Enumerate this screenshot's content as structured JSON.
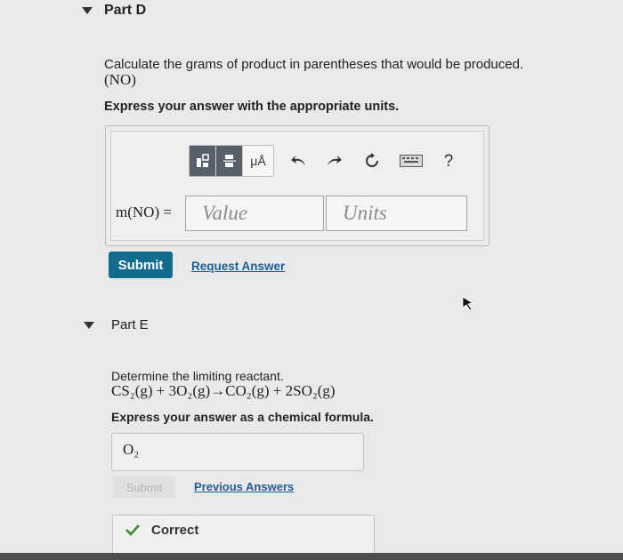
{
  "part_d": {
    "title": "Part D",
    "prompt_line1": "Calculate the grams of product in parentheses that would be produced.",
    "prompt_line2": "(NO)",
    "instruction": "Express your answer with the appropriate units.",
    "toolbar": {
      "template_icon": "templates-icon",
      "units_label": "μÅ",
      "undo_icon": "undo-icon",
      "redo_icon": "redo-icon",
      "reset_icon": "reset-icon",
      "keyboard_icon": "keyboard-icon",
      "help_label": "?"
    },
    "answer_label": "m(NO) =",
    "value_placeholder": "Value",
    "units_placeholder": "Units",
    "submit_label": "Submit",
    "request_answer_label": "Request Answer"
  },
  "part_e": {
    "title": "Part E",
    "prompt": "Determine the limiting reactant.",
    "equation": "CS₂(g) + 3O₂(g)→CO₂(g) + 2SO₂(g)",
    "instruction": "Express your answer as a chemical formula.",
    "answer_value": "O₂",
    "submit_label": "Submit",
    "previous_answers_label": "Previous Answers",
    "status": "Correct",
    "status_color": "#3a8a2e"
  }
}
